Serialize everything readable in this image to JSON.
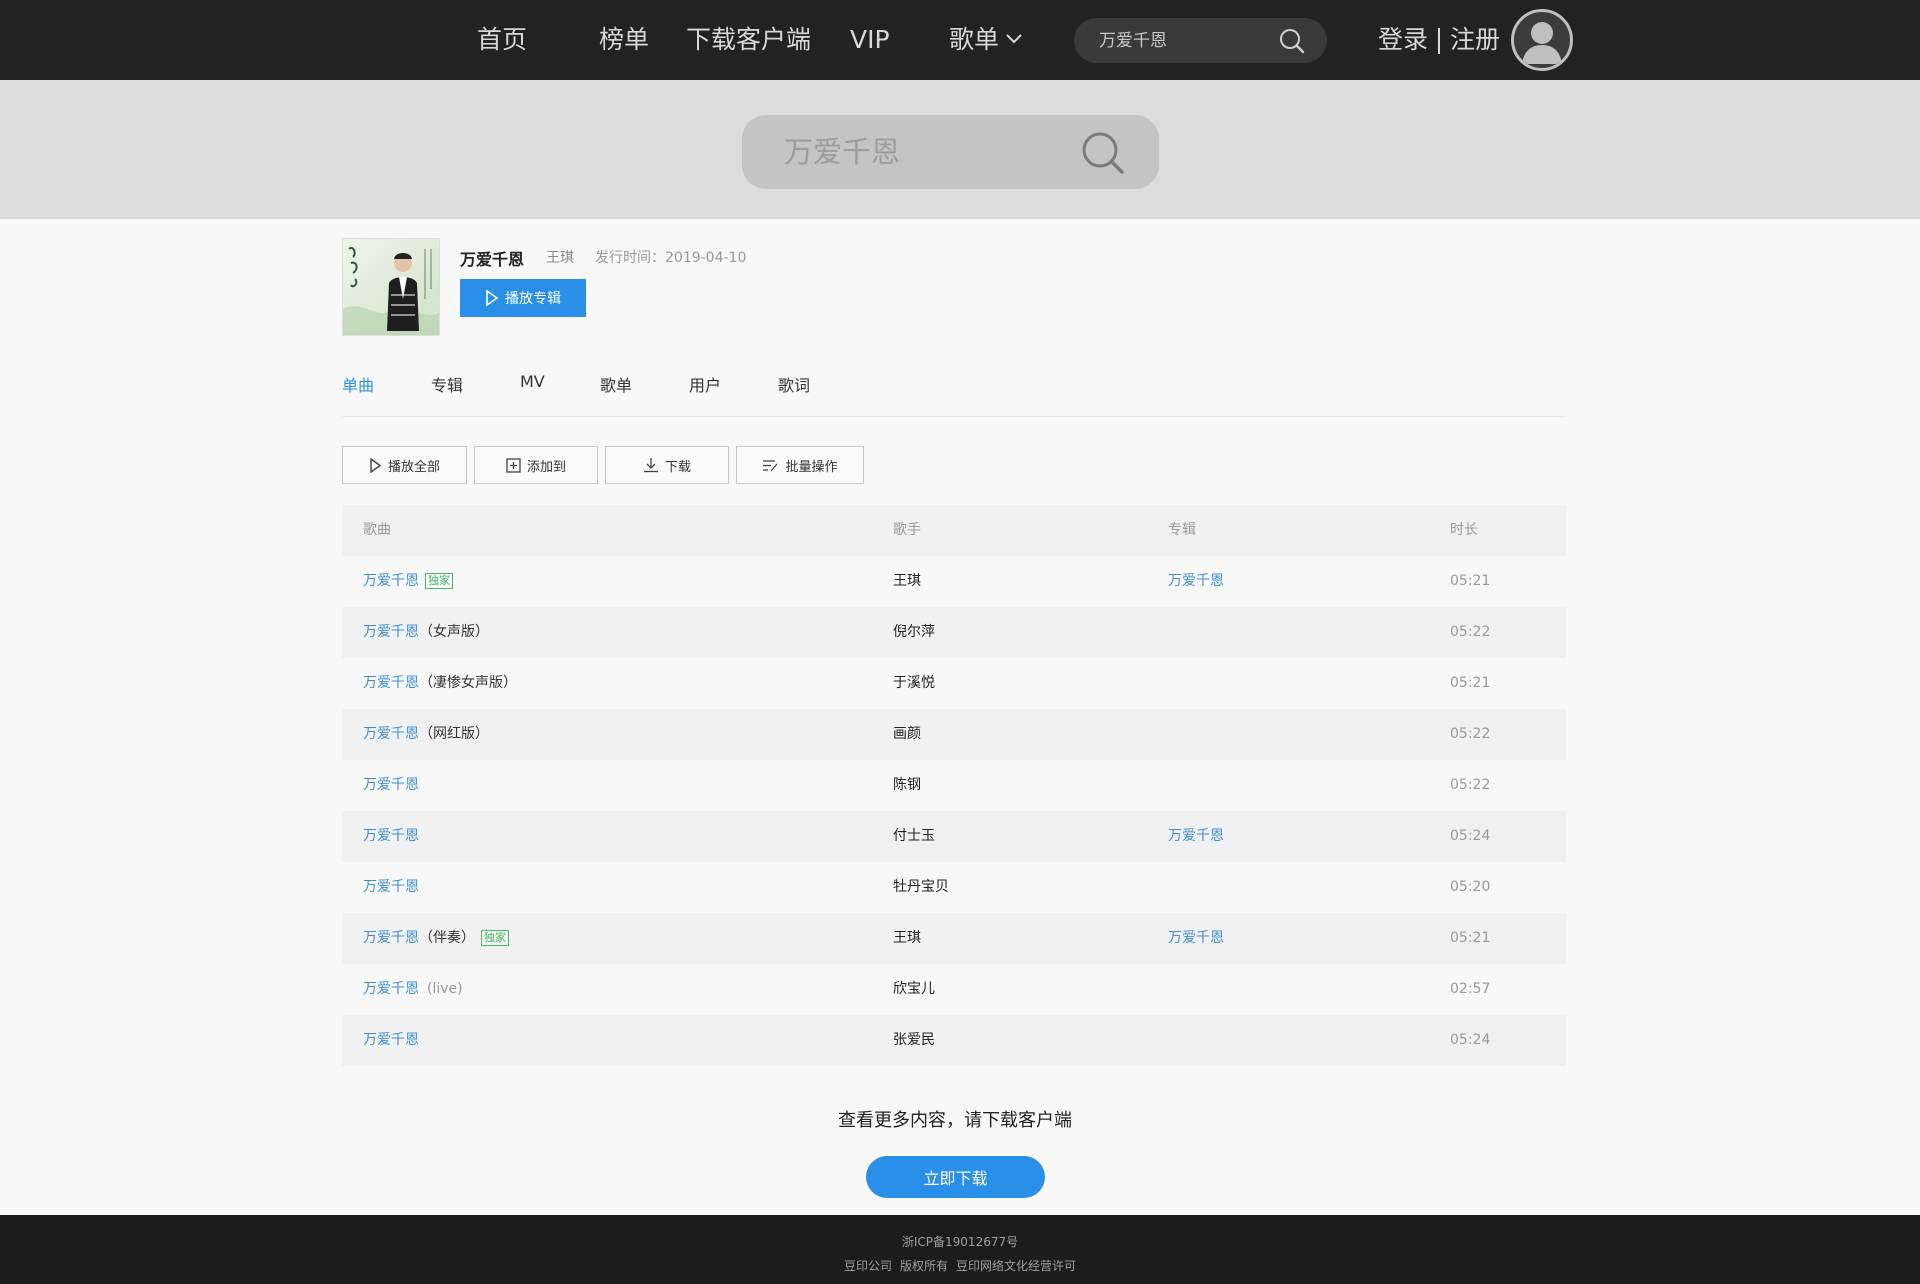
{
  "nav": {
    "home": "首页",
    "charts": "榜单",
    "download_client": "下载客户端",
    "vip": "VIP",
    "playlists": "歌单",
    "search_value": "万爱千恩",
    "login": "登录",
    "register": "注册"
  },
  "hero_search": {
    "placeholder": "万爱千恩"
  },
  "album": {
    "title": "万爱千恩",
    "artist": "王琪",
    "release_date": "发行时间：2019-04-10",
    "play_button": "播放专辑"
  },
  "tabs": [
    "单曲",
    "专辑",
    "MV",
    "歌单",
    "用户",
    "歌词"
  ],
  "toolbar": {
    "play_all": "播放全部",
    "add_to": "添加到",
    "download": "下载",
    "batch": "批量操作"
  },
  "table": {
    "headers": {
      "song": "歌曲",
      "singer": "歌手",
      "album": "专辑",
      "duration": "时长"
    },
    "rows": [
      {
        "title": "万爱千恩",
        "suffix": "",
        "tag": "独家",
        "singer": "王琪",
        "album": "万爱千恩",
        "duration": "05:21"
      },
      {
        "title": "万爱千恩",
        "suffix": "（女声版）",
        "tag": "",
        "singer": "倪尔萍",
        "album": "",
        "duration": "05:22"
      },
      {
        "title": "万爱千恩",
        "suffix": "（凄惨女声版）",
        "tag": "",
        "singer": "于溪悦",
        "album": "",
        "duration": "05:21"
      },
      {
        "title": "万爱千恩",
        "suffix": "（网红版）",
        "tag": "",
        "singer": "画颜",
        "album": "",
        "duration": "05:22"
      },
      {
        "title": "万爱千恩",
        "suffix": "",
        "tag": "",
        "singer": "陈钢",
        "album": "",
        "duration": "05:22"
      },
      {
        "title": "万爱千恩",
        "suffix": "",
        "tag": "",
        "singer": "付士玉",
        "album": "万爱千恩",
        "duration": "05:24"
      },
      {
        "title": "万爱千恩",
        "suffix": "",
        "tag": "",
        "singer": "牡丹宝贝",
        "album": "",
        "duration": "05:20"
      },
      {
        "title": "万爱千恩",
        "suffix": "（伴奏）",
        "tag": "独家",
        "singer": "王琪",
        "album": "万爱千恩",
        "duration": "05:21"
      },
      {
        "title": "万爱千恩",
        "suffix": "(live)",
        "tag": "",
        "singer": "欣宝儿",
        "album": "",
        "duration": "02:57"
      },
      {
        "title": "万爱千恩",
        "suffix": "",
        "tag": "",
        "singer": "张爱民",
        "album": "",
        "duration": "05:24"
      }
    ]
  },
  "more": {
    "text": "查看更多内容，请下载客户端",
    "button": "立即下载"
  },
  "footer": {
    "icp": "浙ICP备19012677号",
    "company": "豆印公司",
    "rights": "版权所有",
    "license": "豆印网络文化经营许可"
  }
}
